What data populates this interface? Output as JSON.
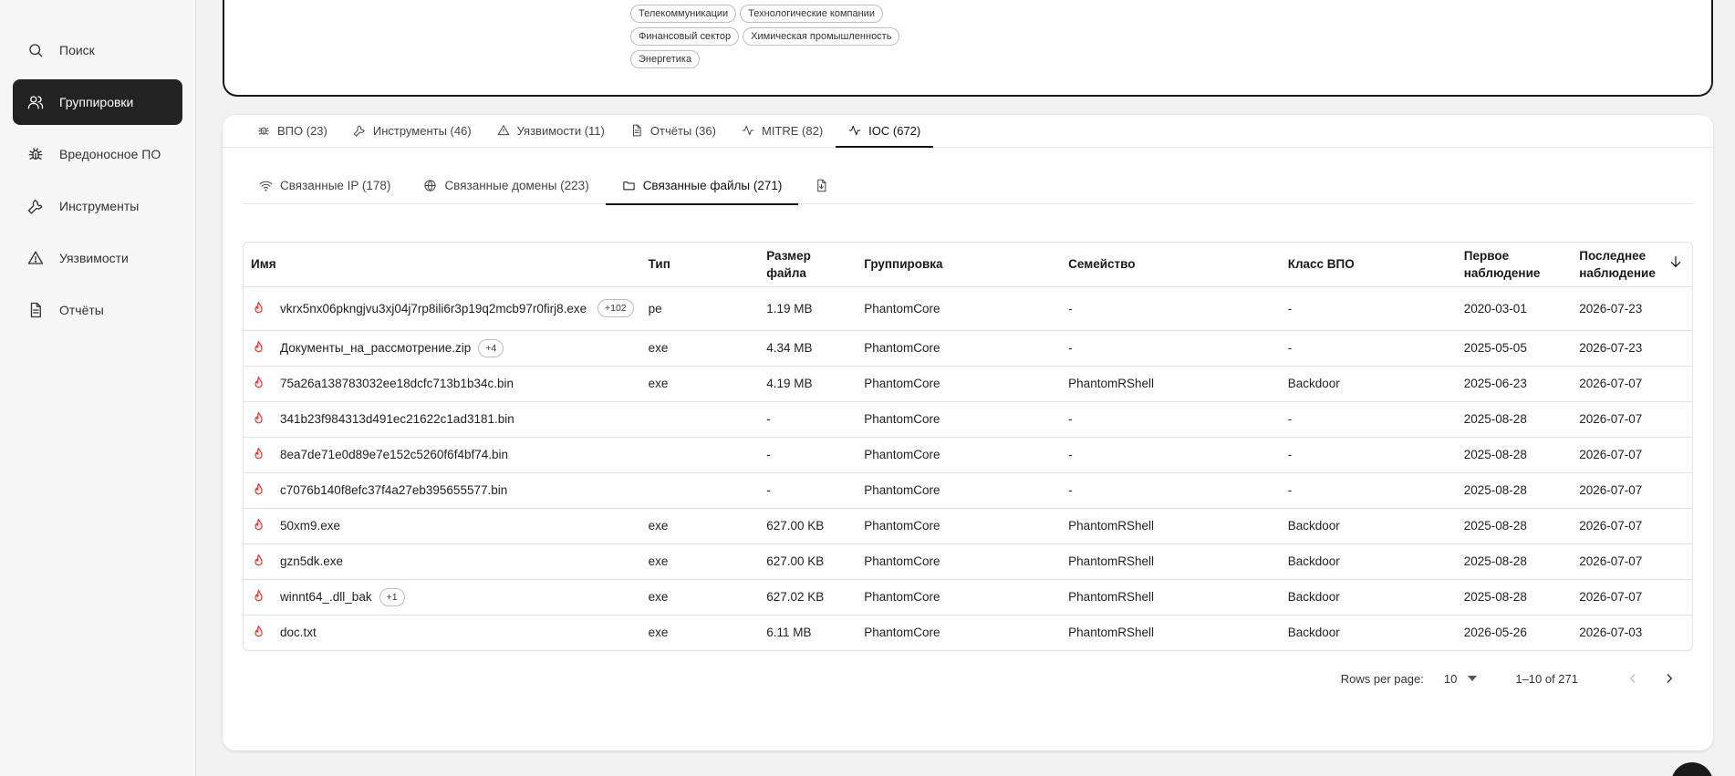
{
  "sidebar": {
    "items": [
      {
        "label": "Поиск",
        "icon": "search-icon"
      },
      {
        "label": "Группировки",
        "icon": "users-icon",
        "active": true
      },
      {
        "label": "Вредоносное ПО",
        "icon": "bug-icon"
      },
      {
        "label": "Инструменты",
        "icon": "wrench-icon"
      },
      {
        "label": "Уязвимости",
        "icon": "warning-icon"
      },
      {
        "label": "Отчёты",
        "icon": "document-icon"
      }
    ]
  },
  "industries": {
    "row1": [
      "Телекоммуникации",
      "Технологические компании"
    ],
    "row2": [
      "Финансовый сектор",
      "Химическая промышленность"
    ],
    "row3": [
      "Энергетика"
    ]
  },
  "tabs": [
    {
      "label": "ВПО (23)",
      "icon": "bug-icon"
    },
    {
      "label": "Инструменты (46)",
      "icon": "wrench-icon"
    },
    {
      "label": "Уязвимости (11)",
      "icon": "warning-icon"
    },
    {
      "label": "Отчёты (36)",
      "icon": "document-icon"
    },
    {
      "label": "MITRE (82)",
      "icon": "activity-icon"
    },
    {
      "label": "IOC (672)",
      "icon": "activity-icon",
      "active": true
    }
  ],
  "subtabs": [
    {
      "label": "Связанные IP (178)",
      "icon": "wifi-icon"
    },
    {
      "label": "Связанные домены (223)",
      "icon": "globe-icon"
    },
    {
      "label": "Связанные файлы (271)",
      "icon": "folder-icon",
      "active": true
    }
  ],
  "table": {
    "headers": {
      "name": "Имя",
      "type": "Тип",
      "size": "Размер файла",
      "group": "Группировка",
      "family": "Семейство",
      "class": "Класс ВПО",
      "first": "Первое наблюдение",
      "last": "Последнее наблюдение"
    },
    "rows": [
      {
        "name": "vkrx5nx06pkngjvu3xj04j7rp8ili6r3p19q2mcb97r0firj8.exe",
        "badge": "+102",
        "type": "pe",
        "size": "1.19 MB",
        "group": "PhantomCore",
        "family": "-",
        "class": "-",
        "first": "2020-03-01",
        "last": "2026-07-23"
      },
      {
        "name": "Документы_на_рассмотрение.zip",
        "badge": "+4",
        "type": "exe",
        "size": "4.34 MB",
        "group": "PhantomCore",
        "family": "-",
        "class": "-",
        "first": "2025-05-05",
        "last": "2026-07-23"
      },
      {
        "name": "75a26a138783032ee18dcfc713b1b34c.bin",
        "badge": "",
        "type": "exe",
        "size": "4.19 MB",
        "group": "PhantomCore",
        "family": "PhantomRShell",
        "class": "Backdoor",
        "first": "2025-06-23",
        "last": "2026-07-07"
      },
      {
        "name": "341b23f984313d491ec21622c1ad3181.bin",
        "badge": "",
        "type": "",
        "size": "-",
        "group": "PhantomCore",
        "family": "-",
        "class": "-",
        "first": "2025-08-28",
        "last": "2026-07-07"
      },
      {
        "name": "8ea7de71e0d89e7e152c5260f6f4bf74.bin",
        "badge": "",
        "type": "",
        "size": "-",
        "group": "PhantomCore",
        "family": "-",
        "class": "-",
        "first": "2025-08-28",
        "last": "2026-07-07"
      },
      {
        "name": "c7076b140f8efc37f4a27eb395655577.bin",
        "badge": "",
        "type": "",
        "size": "-",
        "group": "PhantomCore",
        "family": "-",
        "class": "-",
        "first": "2025-08-28",
        "last": "2026-07-07"
      },
      {
        "name": "50xm9.exe",
        "badge": "",
        "type": "exe",
        "size": "627.00 KB",
        "group": "PhantomCore",
        "family": "PhantomRShell",
        "class": "Backdoor",
        "first": "2025-08-28",
        "last": "2026-07-07"
      },
      {
        "name": "gzn5dk.exe",
        "badge": "",
        "type": "exe",
        "size": "627.00 KB",
        "group": "PhantomCore",
        "family": "PhantomRShell",
        "class": "Backdoor",
        "first": "2025-08-28",
        "last": "2026-07-07"
      },
      {
        "name": "winnt64_.dll_bak",
        "badge": "+1",
        "type": "exe",
        "size": "627.02 KB",
        "group": "PhantomCore",
        "family": "PhantomRShell",
        "class": "Backdoor",
        "first": "2025-08-28",
        "last": "2026-07-07"
      },
      {
        "name": "doc.txt",
        "badge": "",
        "type": "exe",
        "size": "6.11 MB",
        "group": "PhantomCore",
        "family": "PhantomRShell",
        "class": "Backdoor",
        "first": "2026-05-26",
        "last": "2026-07-03"
      }
    ]
  },
  "pagination": {
    "rows_per_page_label": "Rows per page:",
    "rows_per_page": "10",
    "range": "1–10 of 271"
  },
  "colors": {
    "accent": "#1a1a1a",
    "fire": "#e53935"
  }
}
